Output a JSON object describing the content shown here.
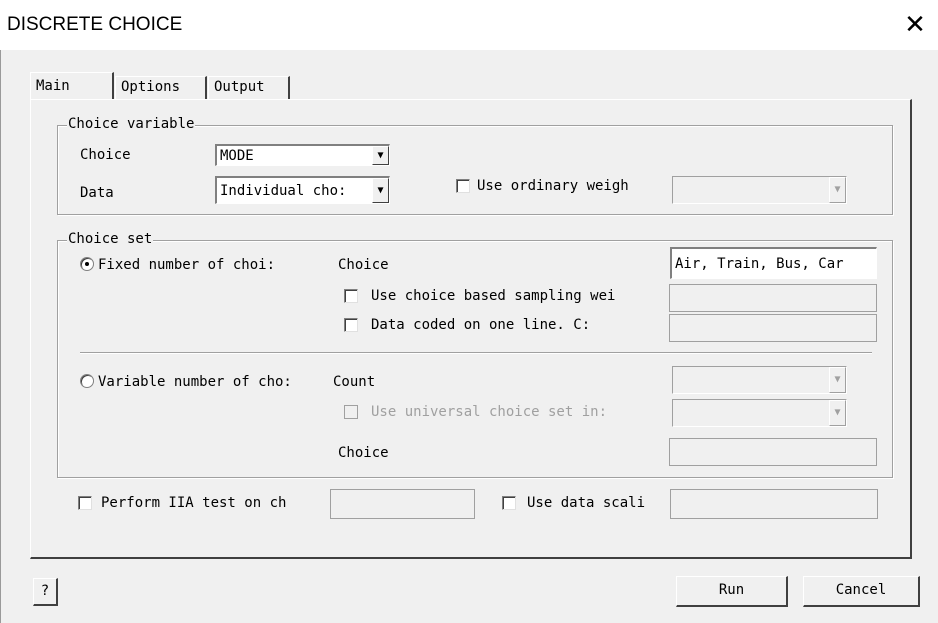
{
  "window": {
    "title": "DISCRETE CHOICE"
  },
  "tabs": [
    {
      "label": "Main",
      "active": true
    },
    {
      "label": "Options",
      "active": false
    },
    {
      "label": "Output",
      "active": false
    }
  ],
  "choice_variable": {
    "label": "Choice variable",
    "choice_label": "Choice",
    "choice_value": "MODE",
    "data_label": "Data",
    "data_value": "Individual cho:",
    "weight_label": "Use ordinary weigh",
    "weight_checked": false,
    "weight_value": ""
  },
  "choice_set": {
    "label": "Choice set",
    "fixed_label": "Fixed number of choi:",
    "fixed_selected": true,
    "choice_label": "Choice",
    "choice_value": "Air, Train, Bus, Car",
    "sampling_label": "Use choice based sampling wei",
    "sampling_checked": false,
    "oneline_label": "Data coded on one line. C:",
    "oneline_checked": false,
    "variable_label": "Variable number of cho:",
    "variable_selected": false,
    "count_label": "Count",
    "universal_label": "Use universal choice set in:",
    "universal_checked": false,
    "choice2_label": "Choice"
  },
  "bottom_options": {
    "iia_label": "Perform IIA test on ch",
    "iia_checked": false,
    "scaling_label": "Use data scali",
    "scaling_checked": false
  },
  "buttons": {
    "help": "?",
    "run": "Run",
    "cancel": "Cancel"
  },
  "icons": {
    "close": "close-icon",
    "dropdown": "chevron-down-icon"
  },
  "colors": {
    "background": "#f0f0f0",
    "titlebar": "#ffffff",
    "field": "#ffffff",
    "disabled_text": "#a0a0a0"
  }
}
